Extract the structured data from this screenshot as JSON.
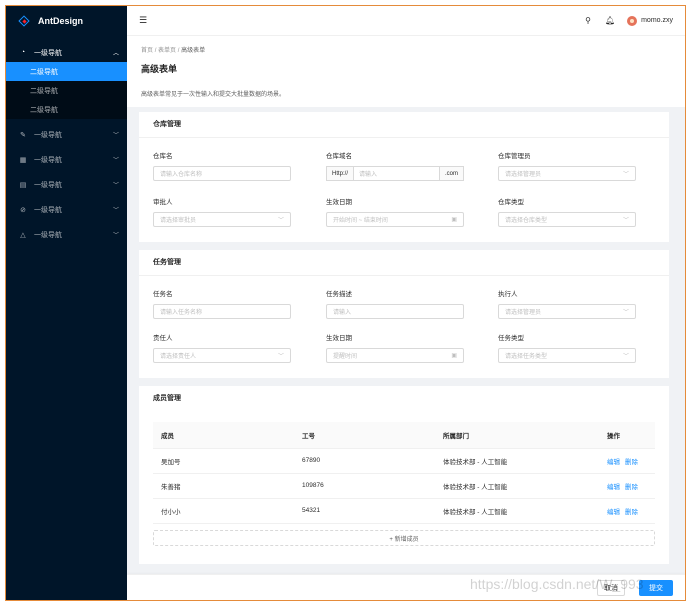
{
  "app": {
    "name": "AntDesign"
  },
  "sidebar": {
    "items": [
      {
        "label": "一级导航",
        "icon": "dashboard-icon",
        "open": true,
        "children": [
          "二级导航",
          "二级导航",
          "二级导航"
        ]
      },
      {
        "label": "一级导航",
        "icon": "form-icon"
      },
      {
        "label": "一级导航",
        "icon": "table-icon"
      },
      {
        "label": "一级导航",
        "icon": "profile-icon"
      },
      {
        "label": "一级导航",
        "icon": "check-circle-icon"
      },
      {
        "label": "一级导航",
        "icon": "warning-icon"
      }
    ]
  },
  "header": {
    "username": "momo.zxy"
  },
  "breadcrumb": [
    "首页",
    "表单页",
    "高级表单"
  ],
  "page": {
    "title": "高级表单",
    "description": "高级表单常见于一次性输入和提交大批量数据的场景。"
  },
  "warehouse": {
    "title": "仓库管理",
    "name_label": "仓库名",
    "name_placeholder": "请输入仓库名称",
    "domain_label": "仓库域名",
    "domain_prefix": "Http://",
    "domain_placeholder": "请输入",
    "domain_suffix": ".com",
    "admin_label": "仓库管理员",
    "admin_placeholder": "请选择管理员",
    "approver_label": "审批人",
    "approver_placeholder": "请选择审批员",
    "date_label": "生效日期",
    "date_placeholder": "开始时间 ~ 结束时间",
    "type_label": "仓库类型",
    "type_placeholder": "请选择仓库类型"
  },
  "task": {
    "title": "任务管理",
    "name_label": "任务名",
    "name_placeholder": "请输入任务名称",
    "desc_label": "任务描述",
    "desc_placeholder": "请输入",
    "exec_label": "执行人",
    "exec_placeholder": "请选择管理员",
    "owner_label": "责任人",
    "owner_placeholder": "请选择责任人",
    "date_label": "生效日期",
    "date_placeholder": "提醒时间",
    "type_label": "任务类型",
    "type_placeholder": "请选择任务类型"
  },
  "members": {
    "title": "成员管理",
    "columns": [
      "成员",
      "工号",
      "所属部门",
      "操作"
    ],
    "rows": [
      {
        "name": "吴加号",
        "id": "67890",
        "dept": "体验技术部 - 人工智能"
      },
      {
        "name": "朱善猪",
        "id": "109876",
        "dept": "体验技术部 - 人工智能"
      },
      {
        "name": "付小小",
        "id": "54321",
        "dept": "体验技术部 - 人工智能"
      }
    ],
    "edit_label": "编辑",
    "delete_label": "删除",
    "add_label": "+ 新增成员"
  },
  "footer": {
    "cancel": "取消",
    "submit": "提交"
  },
  "watermark": "https://blog.csdn.net/W_993"
}
